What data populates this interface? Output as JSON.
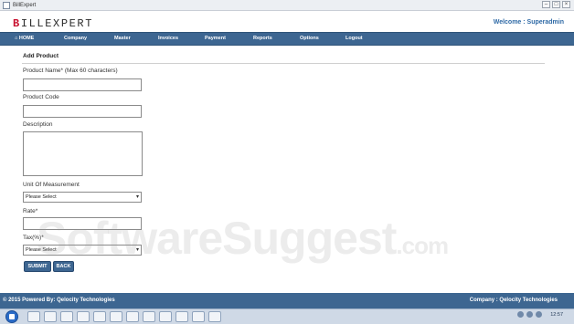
{
  "window": {
    "title": "BillExpert"
  },
  "header": {
    "logo": "BILLEXPERT",
    "welcome": "Welcome : Superadmin"
  },
  "nav": [
    {
      "label": "⌂ HOME"
    },
    {
      "label": "Company"
    },
    {
      "label": "Master"
    },
    {
      "label": "Invoices"
    },
    {
      "label": "Payment"
    },
    {
      "label": "Reports"
    },
    {
      "label": "Options"
    },
    {
      "label": "Logout"
    }
  ],
  "form": {
    "heading": "Add Product",
    "product_name_label": "Product Name* (Max 60 characters)",
    "product_name_value": "",
    "product_code_label": "Product Code",
    "product_code_value": "",
    "description_label": "Description",
    "description_value": "",
    "unit_label": "Unit Of Measurement",
    "unit_selected": "Please Select",
    "rate_label": "Rate*",
    "rate_value": "",
    "tax_label": "Tax(%)*",
    "tax_selected": "Please Select",
    "submit_label": "SUBMIT",
    "back_label": "BACK"
  },
  "watermark": {
    "text": "SoftwareSuggest",
    "suffix": ".com"
  },
  "footer": {
    "left": "© 2015 Powered By: Qelocity Technologies",
    "right": "Company : Qelocity Technologies"
  },
  "taskbar": {
    "clock": "12:57"
  }
}
